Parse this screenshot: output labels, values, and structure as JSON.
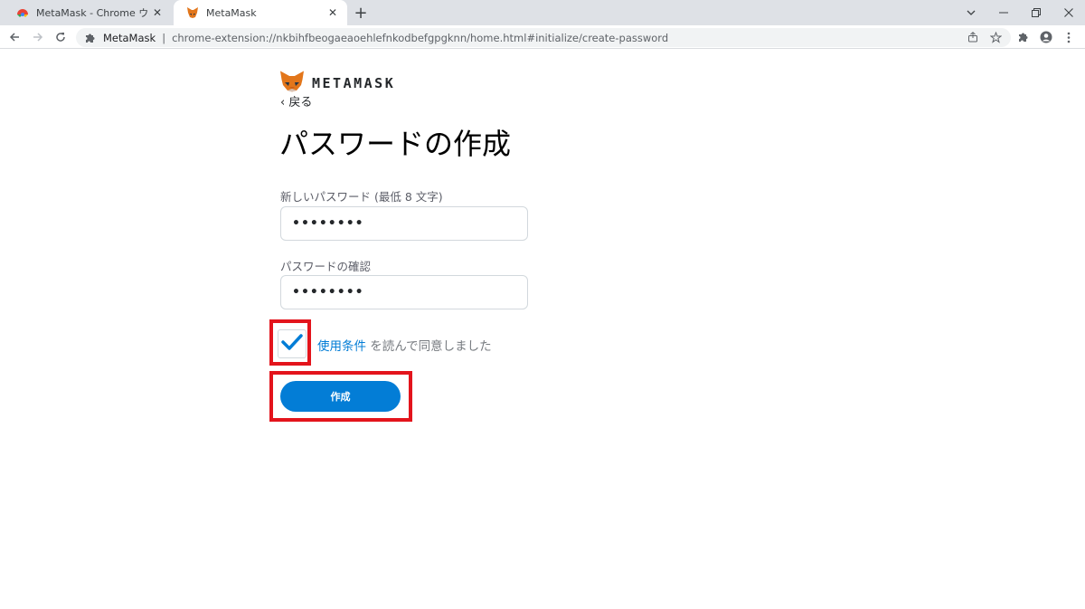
{
  "browser": {
    "tabs": [
      {
        "title": "MetaMask - Chrome ウェブストア",
        "active": false
      },
      {
        "title": "MetaMask",
        "active": true
      }
    ],
    "omnibox": {
      "site_name": "MetaMask",
      "separator": "|",
      "url": "chrome-extension://nkbihfbeogaeaoehlefnkodbefgpgknn/home.html#initialize/create-password"
    }
  },
  "page": {
    "logo_text": "METAMASK",
    "back_label": "‹ 戻る",
    "title": "パスワードの作成",
    "new_password": {
      "label": "新しいパスワード (最低 8 文字)",
      "value": "••••••••"
    },
    "confirm_password": {
      "label": "パスワードの確認",
      "value": "••••••••"
    },
    "terms": {
      "checked": true,
      "link_text": "使用条件",
      "suffix": " を読んで同意しました"
    },
    "create_button_label": "作成"
  },
  "colors": {
    "accent": "#037dd6",
    "highlight": "#e3141c",
    "fox_orange": "#e2761b"
  }
}
